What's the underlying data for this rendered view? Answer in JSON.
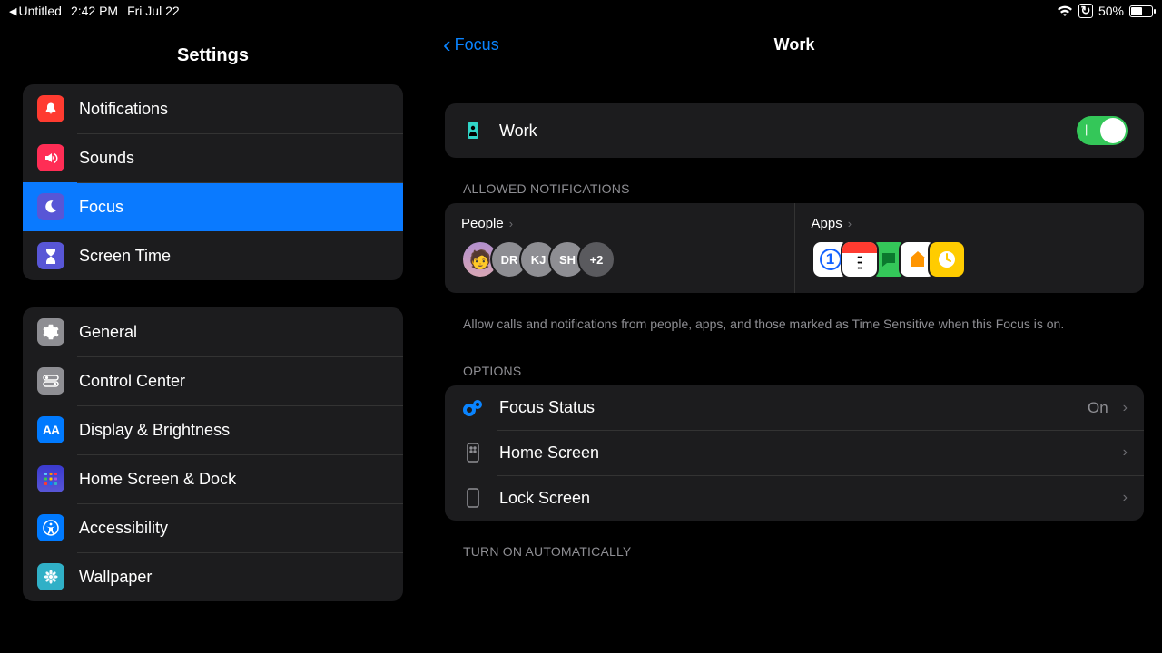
{
  "statusbar": {
    "breadcrumb": "Untitled",
    "time": "2:42 PM",
    "date": "Fri Jul 22",
    "battery_text": "50%"
  },
  "sidebar": {
    "title": "Settings",
    "group1": {
      "notifications": "Notifications",
      "sounds": "Sounds",
      "focus": "Focus",
      "screentime": "Screen Time"
    },
    "group2": {
      "general": "General",
      "controlcenter": "Control Center",
      "display": "Display & Brightness",
      "homescreen": "Home Screen & Dock",
      "accessibility": "Accessibility",
      "wallpaper": "Wallpaper"
    }
  },
  "detail": {
    "back_label": "Focus",
    "title": "Work",
    "work_row_label": "Work",
    "work_toggle_on": true,
    "allowed_header": "ALLOWED NOTIFICATIONS",
    "people_label": "People",
    "apps_label": "Apps",
    "people": {
      "p1": "DR",
      "p2": "KJ",
      "p3": "SH",
      "more": "+2"
    },
    "app_1pass": "1",
    "helper_text": "Allow calls and notifications from people, apps, and those marked as Time Sensitive when this Focus is on.",
    "options_header": "OPTIONS",
    "focus_status_label": "Focus Status",
    "focus_status_value": "On",
    "home_screen_label": "Home Screen",
    "lock_screen_label": "Lock Screen",
    "auto_header": "TURN ON AUTOMATICALLY"
  }
}
